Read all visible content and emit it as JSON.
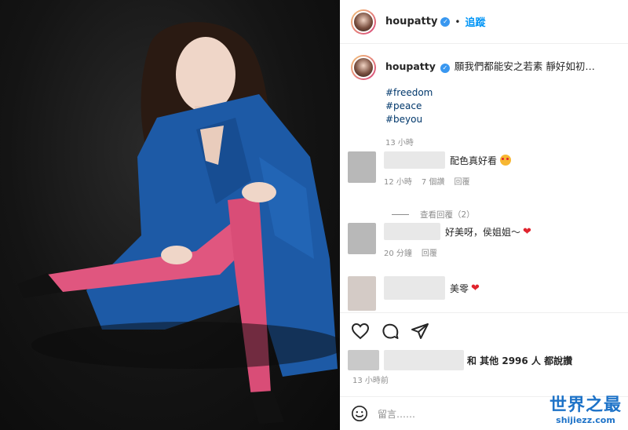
{
  "post": {
    "username": "houpatty",
    "verified_glyph": "✓",
    "separator": "•",
    "follow_label": "追蹤",
    "caption": "願我們都能安之若素 靜好如初…",
    "hashtags": [
      "#freedom",
      "#peace",
      "#beyou"
    ],
    "caption_time": "13 小時"
  },
  "comments": [
    {
      "text": "配色真好看",
      "emoji": "star-struck-emoji",
      "meta_time": "12 小時",
      "meta_likes": "7 個讚",
      "meta_reply": "回覆"
    },
    {
      "text": "好美呀，侯姐姐～",
      "emoji": "heart",
      "meta_time": "20 分鐘",
      "meta_reply": "回覆"
    },
    {
      "text": "美零",
      "emoji": "heart"
    }
  ],
  "view_replies": "查看回覆（2）",
  "icons": {
    "like": "heart-outline-icon",
    "comment": "comment-bubble-icon",
    "share": "paper-plane-icon",
    "emoji": "smiley-icon"
  },
  "likes_text": "和 其他 2996 人 都說讚",
  "post_time": "13 小時前",
  "comment_placeholder": "留言……",
  "watermark": {
    "title": "世界之最",
    "url": "shijiezz.com"
  },
  "colors": {
    "accent": "#0095f6",
    "heart": "#e0242e",
    "hashtag": "#00376b",
    "watermark": "#1e73c8",
    "coat": "#1d5aa6",
    "tights": "#e0567f"
  }
}
